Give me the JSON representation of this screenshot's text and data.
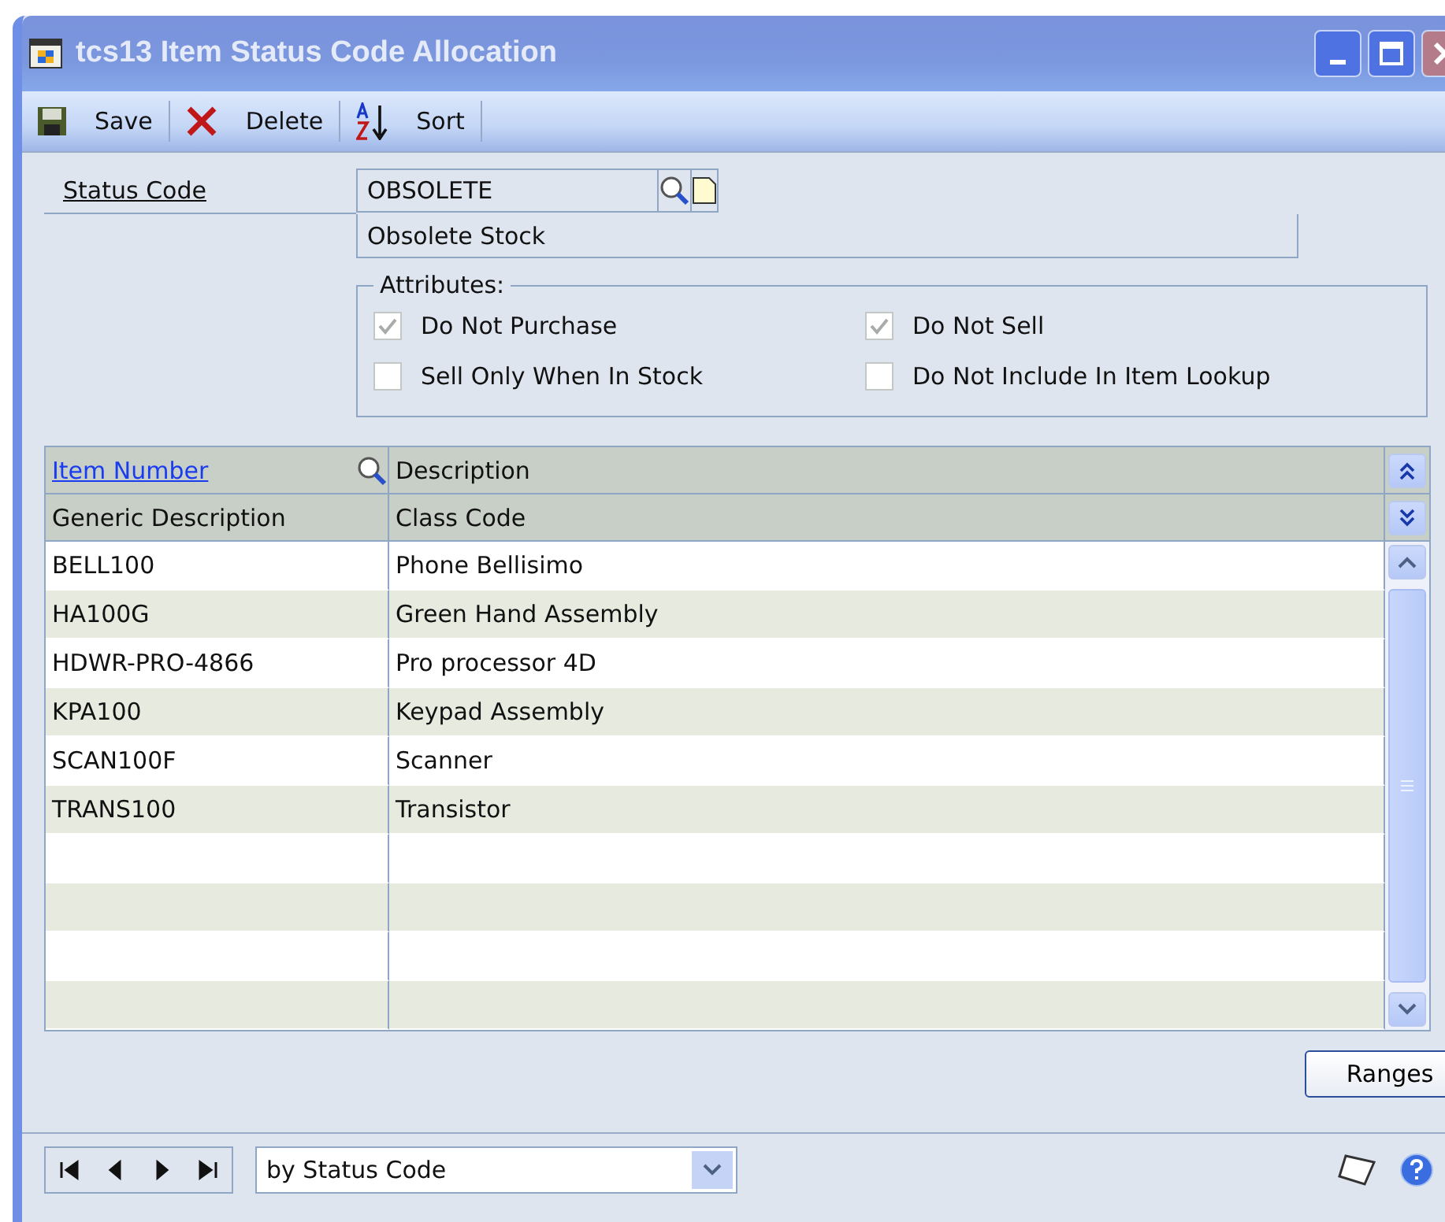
{
  "window": {
    "title": "tcs13 Item Status Code Allocation"
  },
  "toolbar": [
    {
      "label": "Save",
      "kind": "save"
    },
    {
      "label": "Delete",
      "kind": "delete"
    },
    {
      "label": "Sort",
      "kind": "sort"
    }
  ],
  "status_code": {
    "label": "Status Code",
    "value": "OBSOLETE",
    "description": "Obsolete Stock"
  },
  "attributes": {
    "title": "Attributes:",
    "items": [
      {
        "label": "Do Not Purchase",
        "checked": true
      },
      {
        "label": "Do Not Sell",
        "checked": true
      },
      {
        "label": "Sell Only When In Stock",
        "checked": false
      },
      {
        "label": "Do Not Include In Item Lookup",
        "checked": false
      }
    ]
  },
  "grid": {
    "columns": [
      {
        "label": "Item Number",
        "link": true
      },
      {
        "label": "Description",
        "link": false
      }
    ],
    "subcolumns": [
      "Generic Description",
      "Class Code"
    ],
    "rows": [
      [
        "BELL100",
        "Phone Bellisimo"
      ],
      [
        "HA100G",
        "Green Hand Assembly"
      ],
      [
        "HDWR-PRO-4866",
        "Pro processor 4D"
      ],
      [
        "KPA100",
        "Keypad Assembly"
      ],
      [
        "SCAN100F",
        "Scanner"
      ],
      [
        "TRANS100",
        "Transistor"
      ]
    ]
  },
  "buttons": [
    "Ranges"
  ],
  "footer": {
    "sort_by": "by Status Code"
  }
}
